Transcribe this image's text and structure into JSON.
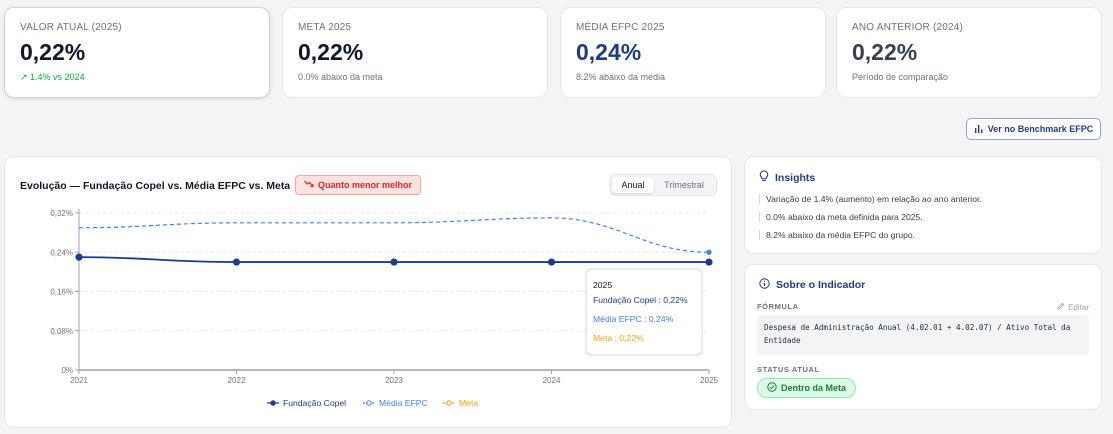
{
  "kpis": [
    {
      "label": "VALOR ATUAL (2025)",
      "value": "0,22%",
      "sub": "↗ 1.4% vs 2024"
    },
    {
      "label": "META 2025",
      "value": "0,22%",
      "sub": "0.0% abaixo da meta"
    },
    {
      "label": "MÉDIA EFPC 2025",
      "value": "0,24%",
      "sub": "8.2% abaixo da média"
    },
    {
      "label": "ANO ANTERIOR (2024)",
      "value": "0,22%",
      "sub": "Período de comparação"
    }
  ],
  "benchmark_button": "Ver no Benchmark EFPC",
  "chart_card": {
    "title": "Evolução — Fundação Copel vs. Média EFPC vs. Meta",
    "badge": "Quanto menor melhor",
    "toggle": {
      "on": "Anual",
      "off": "Trimestral"
    }
  },
  "chart_data": {
    "type": "line",
    "x": [
      "2021",
      "2022",
      "2023",
      "2024",
      "2025"
    ],
    "yticks": [
      "0%",
      "0,08%",
      "0,16%",
      "0,24%",
      "0,32%"
    ],
    "ylim": [
      0,
      0.32
    ],
    "grid": true,
    "legend_position": "bottom",
    "series": [
      {
        "name": "Fundação Copel",
        "color": "#1e3a8a",
        "style": "solid",
        "values": [
          0.23,
          0.22,
          0.22,
          0.22,
          0.22
        ]
      },
      {
        "name": "Média EFPC",
        "color": "#3b82f6",
        "style": "dashed",
        "values": [
          0.29,
          0.3,
          0.3,
          0.31,
          0.24
        ]
      },
      {
        "name": "Meta",
        "color": "#f59e0b",
        "style": "dashed",
        "values": [
          0.23,
          0.22,
          0.22,
          0.22,
          0.22
        ]
      }
    ],
    "tooltip": {
      "title": "2025",
      "lines": [
        "Fundação Copel : 0,22%",
        "Média EFPC : 0,24%",
        "Meta : 0,22%"
      ]
    }
  },
  "insights": {
    "title": "Insights",
    "items": [
      "Variação de 1.4% (aumento) em relação ao ano anterior.",
      "0.0% abaixo da meta definida para 2025.",
      "8.2% abaixo da média EFPC do grupo."
    ]
  },
  "about": {
    "title": "Sobre o Indicador",
    "formula_label": "FÓRMULA",
    "edit_label": "Editar",
    "formula": "Despesa de Administração Anual (4.02.01 + 4.02.07) / Ativo Total da Entidade",
    "status_label": "STATUS ATUAL",
    "status": "Dentro da Meta"
  }
}
